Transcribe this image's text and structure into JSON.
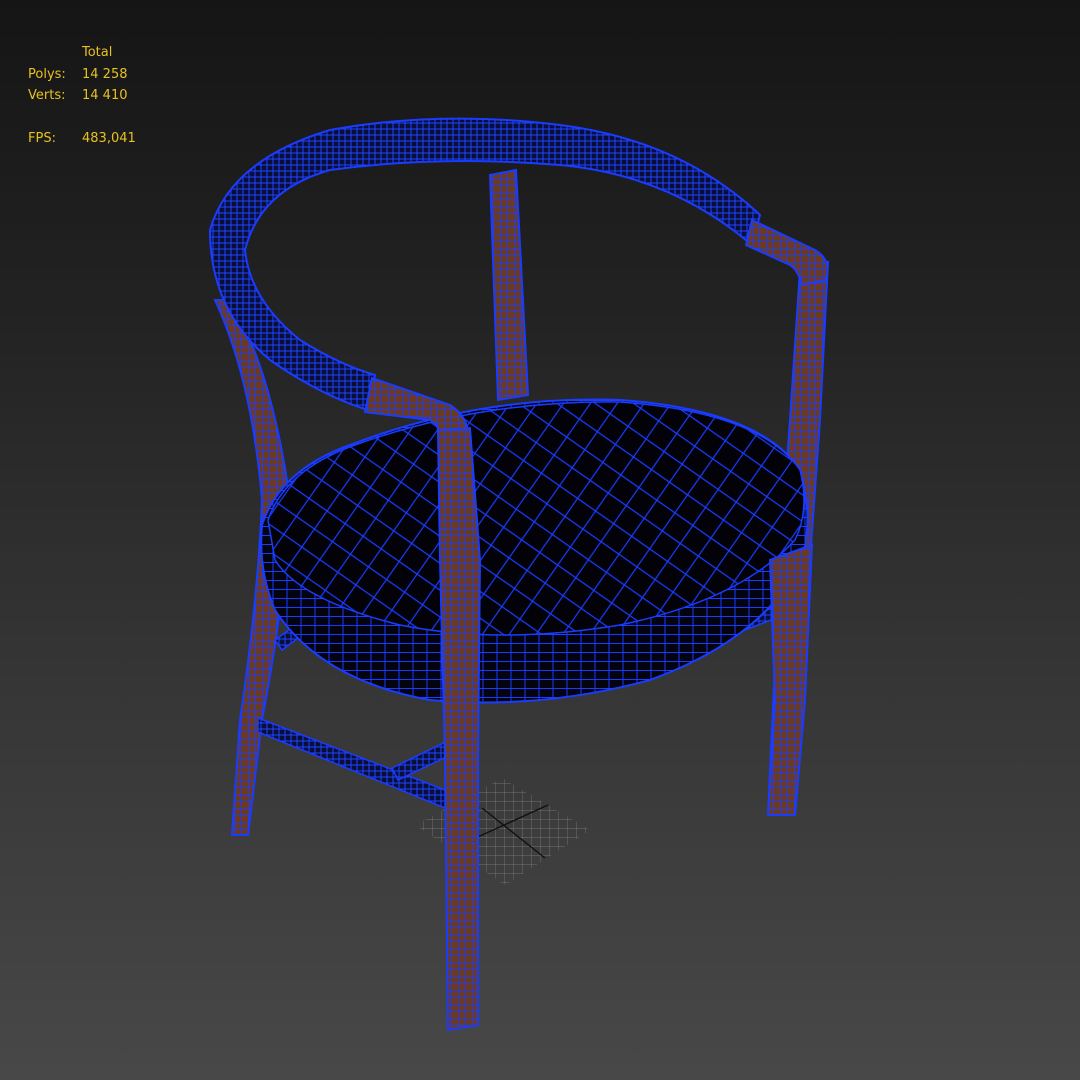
{
  "stats_overlay": {
    "header": "Total",
    "polys_label": "Polys:",
    "polys_value": "14 258",
    "verts_label": "Verts:",
    "verts_value": "14 410",
    "fps_label": "FPS:",
    "fps_value": "483,041"
  },
  "viewport": {
    "render_mode": "shaded-with-wireframe",
    "model": "armchair",
    "colors": {
      "background_top": "#151515",
      "background_bottom": "#484848",
      "wire": "#1a3cff",
      "wood": "#6b3a22",
      "seat_fill": "#020208",
      "stats_text": "#e8c022",
      "grid": "#9a9a9a"
    }
  }
}
